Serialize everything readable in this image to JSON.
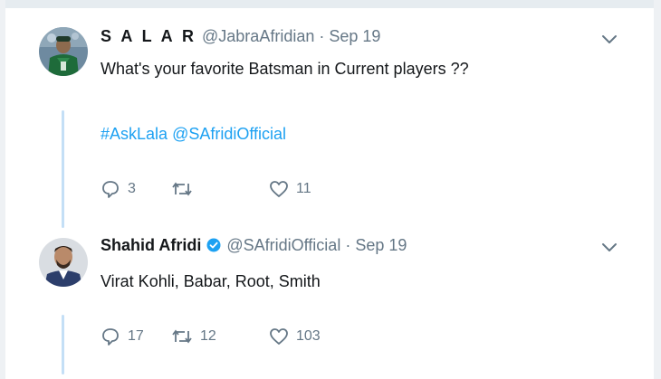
{
  "tweets": [
    {
      "display_name": "S A L A R",
      "handle": "@JabraAfridian",
      "separator": "·",
      "date": "Sep 19",
      "text": "What's your favorite Batsman in Current players ??",
      "hashtag": "#AskLala",
      "mention": "@SAfridiOfficial",
      "reply_count": "3",
      "retweet_count": "",
      "like_count": "11",
      "verified": false
    },
    {
      "display_name": "Shahid Afridi",
      "handle": "@SAfridiOfficial",
      "separator": "·",
      "date": "Sep 19",
      "text": "Virat Kohli, Babar, Root, Smith",
      "reply_count": "17",
      "retweet_count": "12",
      "like_count": "103",
      "verified": true
    }
  ],
  "icons": {
    "reply": "reply-icon",
    "retweet": "retweet-icon",
    "like": "heart-icon",
    "menu": "chevron-down-icon",
    "verified": "verified-badge-icon"
  },
  "colors": {
    "link": "#1da1f2",
    "muted": "#657786",
    "thread_line": "#c4dff6",
    "text": "#14171a"
  }
}
